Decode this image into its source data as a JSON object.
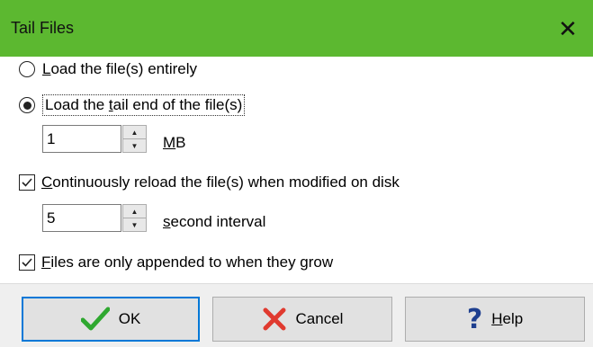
{
  "window": {
    "title": "Tail Files",
    "close_glyph": "✕"
  },
  "options": {
    "load_entire_prefix": "L",
    "load_entire_rest": "oad the file(s) entirely",
    "load_tail_pre": "Load the ",
    "load_tail_u": "t",
    "load_tail_post": "ail end of the file(s)",
    "tail_size_value": "1",
    "tail_size_unit_u": "M",
    "tail_size_unit_rest": "B",
    "reload_u": "C",
    "reload_rest": "ontinuously reload the file(s) when modified on disk",
    "interval_value": "5",
    "interval_unit_u": "s",
    "interval_unit_rest": "econd interval",
    "append_u": "F",
    "append_rest": "iles are only appended to when they grow"
  },
  "state": {
    "load_mode": "tail",
    "reload_checked": true,
    "append_checked": true
  },
  "buttons": {
    "ok_label": "OK",
    "cancel_label": "Cancel",
    "help_u": "H",
    "help_rest": "elp"
  },
  "colors": {
    "titlebar": "#5cb830",
    "ok_icon": "#2fa830",
    "cancel_icon": "#e03a2f",
    "help_icon": "#1e3f8f"
  }
}
